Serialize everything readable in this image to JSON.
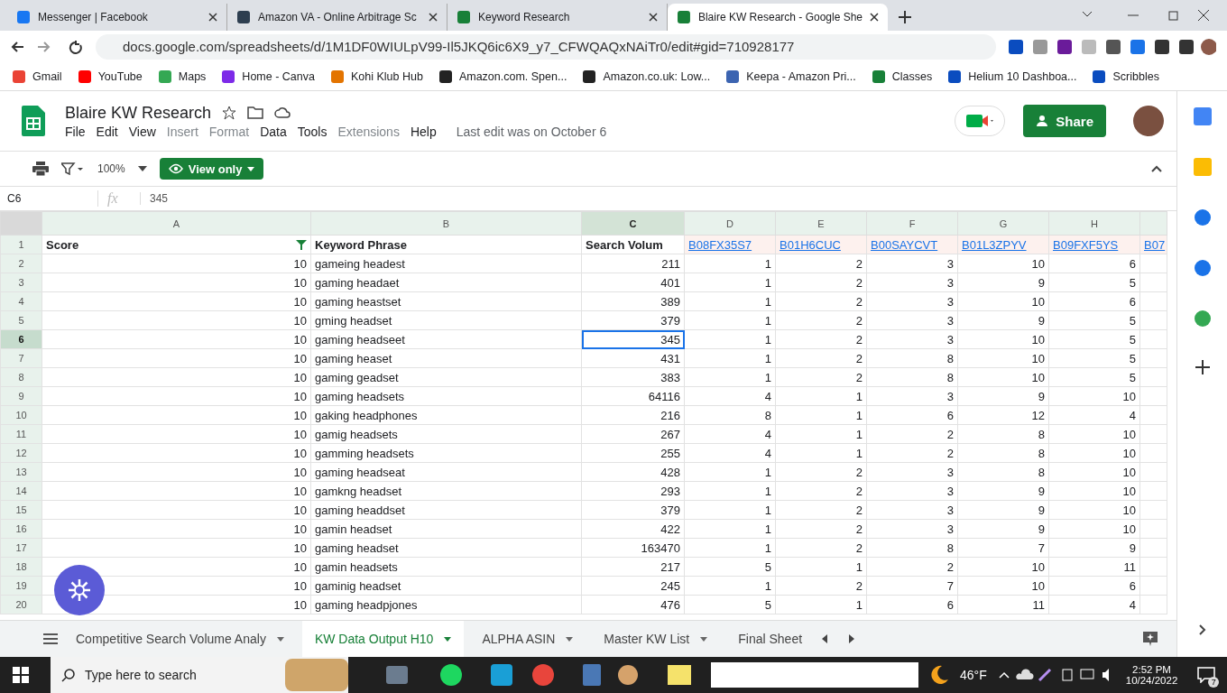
{
  "browser": {
    "tabs": [
      {
        "title": "Messenger | Facebook",
        "selected": false
      },
      {
        "title": "Amazon VA - Online Arbitrage Sc",
        "selected": false
      },
      {
        "title": "Keyword Research",
        "selected": false
      },
      {
        "title": "Blaire KW Research - Google She",
        "selected": true
      }
    ],
    "url": "docs.google.com/spreadsheets/d/1M1DF0WIULpV99-Il5JKQ6ic6X9_y7_CFWQAQxNAiTr0/edit#gid=710928177",
    "bookmarks": [
      "Gmail",
      "YouTube",
      "Maps",
      "Home - Canva",
      "Kohi Klub Hub",
      "Amazon.com. Spen...",
      "Amazon.co.uk: Low...",
      "Keepa - Amazon Pri...",
      "Classes",
      "Helium 10 Dashboa...",
      "Scribbles"
    ]
  },
  "doc": {
    "title": "Blaire KW Research",
    "menu": [
      {
        "label": "File",
        "disabled": false
      },
      {
        "label": "Edit",
        "disabled": false
      },
      {
        "label": "View",
        "disabled": false
      },
      {
        "label": "Insert",
        "disabled": true
      },
      {
        "label": "Format",
        "disabled": true
      },
      {
        "label": "Data",
        "disabled": false
      },
      {
        "label": "Tools",
        "disabled": false
      },
      {
        "label": "Extensions",
        "disabled": true
      },
      {
        "label": "Help",
        "disabled": false
      }
    ],
    "last_edit": "Last edit was on October 6",
    "share": "Share"
  },
  "toolbar": {
    "zoom": "100%",
    "mode": "View only"
  },
  "formula_bar": {
    "cell_ref": "C6",
    "fx_label": "fx",
    "value": "345"
  },
  "grid": {
    "columns": [
      {
        "label": "A",
        "selected": false
      },
      {
        "label": "B",
        "selected": false
      },
      {
        "label": "C",
        "selected": true
      },
      {
        "label": "D",
        "selected": false
      },
      {
        "label": "E",
        "selected": false
      },
      {
        "label": "F",
        "selected": false
      },
      {
        "label": "G",
        "selected": false
      },
      {
        "label": "H",
        "selected": false
      }
    ],
    "header_row": {
      "num": "1",
      "cells": [
        "Score",
        "Keyword Phrase",
        "Search Volum"
      ],
      "links": [
        "B08FX35S7",
        "B01H6CUC",
        "B00SAYCVT",
        "B01L3ZPYV",
        "B09FXF5YS",
        "B07"
      ]
    },
    "rows": [
      {
        "num": "2",
        "selected": false,
        "cells": [
          "10",
          "gameing headest",
          "211",
          "1",
          "2",
          "3",
          "10",
          "6"
        ]
      },
      {
        "num": "3",
        "selected": false,
        "cells": [
          "10",
          "gaming headaet",
          "401",
          "1",
          "2",
          "3",
          "9",
          "5"
        ]
      },
      {
        "num": "4",
        "selected": false,
        "cells": [
          "10",
          "gaming heastset",
          "389",
          "1",
          "2",
          "3",
          "10",
          "6"
        ]
      },
      {
        "num": "5",
        "selected": false,
        "cells": [
          "10",
          "gming headset",
          "379",
          "1",
          "2",
          "3",
          "9",
          "5"
        ]
      },
      {
        "num": "6",
        "selected": true,
        "cells": [
          "10",
          "gaming headseet",
          "345",
          "1",
          "2",
          "3",
          "10",
          "5"
        ]
      },
      {
        "num": "7",
        "selected": false,
        "cells": [
          "10",
          "gaming heaset",
          "431",
          "1",
          "2",
          "8",
          "10",
          "5"
        ]
      },
      {
        "num": "8",
        "selected": false,
        "cells": [
          "10",
          "gaming geadset",
          "383",
          "1",
          "2",
          "8",
          "10",
          "5"
        ]
      },
      {
        "num": "9",
        "selected": false,
        "cells": [
          "10",
          "gaming headsets",
          "64116",
          "4",
          "1",
          "3",
          "9",
          "10"
        ]
      },
      {
        "num": "10",
        "selected": false,
        "cells": [
          "10",
          "gaking headphones",
          "216",
          "8",
          "1",
          "6",
          "12",
          "4"
        ]
      },
      {
        "num": "11",
        "selected": false,
        "cells": [
          "10",
          "gamig headsets",
          "267",
          "4",
          "1",
          "2",
          "8",
          "10"
        ]
      },
      {
        "num": "12",
        "selected": false,
        "cells": [
          "10",
          "gamming headsets",
          "255",
          "4",
          "1",
          "2",
          "8",
          "10"
        ]
      },
      {
        "num": "13",
        "selected": false,
        "cells": [
          "10",
          "gaming headseat",
          "428",
          "1",
          "2",
          "3",
          "8",
          "10"
        ]
      },
      {
        "num": "14",
        "selected": false,
        "cells": [
          "10",
          "gamkng headset",
          "293",
          "1",
          "2",
          "3",
          "9",
          "10"
        ]
      },
      {
        "num": "15",
        "selected": false,
        "cells": [
          "10",
          "gaming headdset",
          "379",
          "1",
          "2",
          "3",
          "9",
          "10"
        ]
      },
      {
        "num": "16",
        "selected": false,
        "cells": [
          "10",
          "gamin headset",
          "422",
          "1",
          "2",
          "3",
          "9",
          "10"
        ]
      },
      {
        "num": "17",
        "selected": false,
        "cells": [
          "10",
          "gaming headset",
          "163470",
          "1",
          "2",
          "8",
          "7",
          "9"
        ]
      },
      {
        "num": "18",
        "selected": false,
        "cells": [
          "10",
          "gamin headsets",
          "217",
          "5",
          "1",
          "2",
          "10",
          "11"
        ]
      },
      {
        "num": "19",
        "selected": false,
        "cells": [
          "10",
          "gaminig headset",
          "245",
          "1",
          "2",
          "7",
          "10",
          "6"
        ]
      },
      {
        "num": "20",
        "selected": false,
        "cells": [
          "10",
          "gaming headpjones",
          "476",
          "5",
          "1",
          "6",
          "11",
          "4"
        ]
      }
    ]
  },
  "sheet_tabs": [
    {
      "label": "Competitive Search Volume Analy",
      "selected": false
    },
    {
      "label": "KW Data Output H10",
      "selected": true
    },
    {
      "label": "ALPHA ASIN",
      "selected": false
    },
    {
      "label": "Master KW List",
      "selected": false
    },
    {
      "label": "Final Sheet",
      "selected": false
    }
  ],
  "taskbar": {
    "search_placeholder": "Type here to search",
    "weather": "46°F",
    "time": "2:52 PM",
    "date": "10/24/2022",
    "notifications": "7"
  }
}
